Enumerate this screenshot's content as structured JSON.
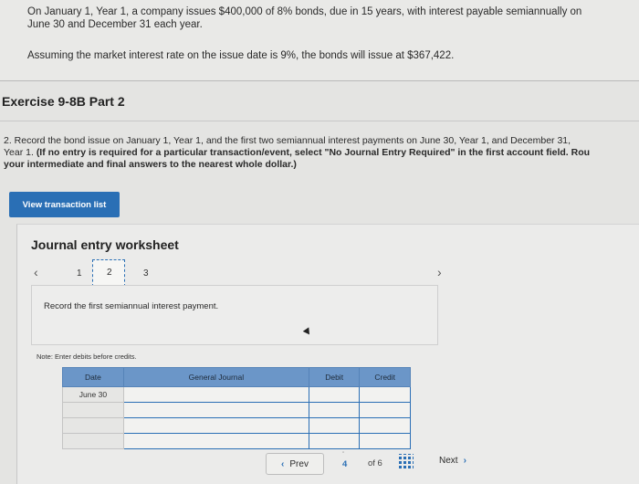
{
  "intro": {
    "line1": "On January 1, Year 1, a company issues $400,000 of 8% bonds, due in 15 years, with interest payable semiannually on",
    "line2": "June 30 and December 31 each year.",
    "assumption": "Assuming the market interest rate on the issue date is 9%, the bonds will issue at $367,422."
  },
  "exercise": {
    "title": "Exercise 9-8B Part 2"
  },
  "requirement": {
    "line1": "2. Record the bond issue on January 1, Year 1, and the first two semiannual interest payments on June 30, Year 1, and December 31,",
    "line2_plain": "Year 1. ",
    "line2_bold": "(If no entry is required for a particular transaction/event, select \"No Journal Entry Required\" in the first account field. Rou",
    "line3_bold": "your intermediate and final answers to the nearest whole dollar.)"
  },
  "buttons": {
    "view_transaction_list": "View transaction list"
  },
  "worksheet": {
    "title": "Journal entry worksheet",
    "pages": [
      "1",
      "2",
      "3"
    ],
    "current_page": "2",
    "description": "Record the first semiannual interest payment.",
    "note": "Note: Enter debits before credits."
  },
  "journal": {
    "headers": {
      "date": "Date",
      "general_journal": "General Journal",
      "debit": "Debit",
      "credit": "Credit"
    },
    "rows": [
      {
        "date": "June 30"
      },
      {
        "date": ""
      },
      {
        "date": ""
      },
      {
        "date": ""
      }
    ]
  },
  "pagination": {
    "prev_label": "Prev",
    "next_label": "Next",
    "current": "4",
    "of_label": "of 6"
  },
  "icons": {
    "left": "chevron-left-icon",
    "right": "chevron-right-icon",
    "grid": "grid-icon"
  },
  "colors": {
    "accent": "#2a6fb5",
    "table_header": "#6b96c8"
  }
}
